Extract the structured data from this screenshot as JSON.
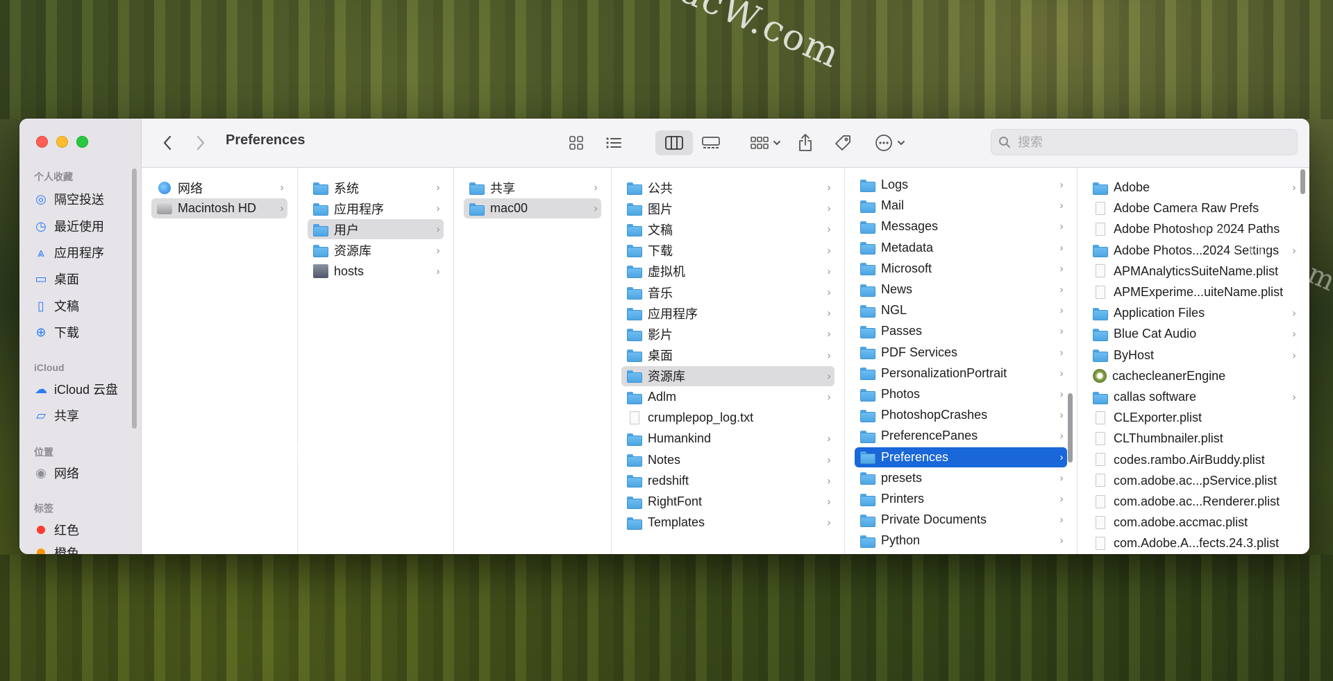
{
  "window": {
    "title": "Preferences"
  },
  "search": {
    "placeholder": "搜索",
    "value": ""
  },
  "watermark": "MacW.com",
  "sidebar": {
    "sections": [
      {
        "title": "个人收藏",
        "items": [
          {
            "label": "隔空投送",
            "icon": "airdrop-icon"
          },
          {
            "label": "最近使用",
            "icon": "clock-icon"
          },
          {
            "label": "应用程序",
            "icon": "applications-icon"
          },
          {
            "label": "桌面",
            "icon": "desktop-icon"
          },
          {
            "label": "文稿",
            "icon": "document-icon"
          },
          {
            "label": "下载",
            "icon": "download-icon"
          }
        ]
      },
      {
        "title": "iCloud",
        "items": [
          {
            "label": "iCloud 云盘",
            "icon": "cloud-icon"
          },
          {
            "label": "共享",
            "icon": "shared-folder-icon"
          }
        ]
      },
      {
        "title": "位置",
        "items": [
          {
            "label": "网络",
            "icon": "network-icon"
          }
        ]
      },
      {
        "title": "标签",
        "items": [
          {
            "label": "红色",
            "icon": "red-tag-icon",
            "color": "#ff3b30"
          },
          {
            "label": "橙色",
            "icon": "orange-tag-icon",
            "color": "#ff9500"
          }
        ]
      }
    ]
  },
  "columns": [
    {
      "items": [
        {
          "label": "网络",
          "icon": "globe",
          "sel": ""
        },
        {
          "label": "Macintosh HD",
          "icon": "disk",
          "sel": "grey"
        }
      ]
    },
    {
      "items": [
        {
          "label": "系统",
          "icon": "folder",
          "sel": ""
        },
        {
          "label": "应用程序",
          "icon": "folder",
          "sel": ""
        },
        {
          "label": "用户",
          "icon": "folder",
          "sel": "grey"
        },
        {
          "label": "资源库",
          "icon": "folder",
          "sel": ""
        },
        {
          "label": "hosts",
          "icon": "hosts",
          "sel": ""
        }
      ]
    },
    {
      "items": [
        {
          "label": "共享",
          "icon": "folder",
          "sel": ""
        },
        {
          "label": "mac00",
          "icon": "folder",
          "sel": "grey"
        }
      ]
    },
    {
      "items": [
        {
          "label": "公共",
          "icon": "folder",
          "sel": ""
        },
        {
          "label": "图片",
          "icon": "folder",
          "sel": ""
        },
        {
          "label": "文稿",
          "icon": "folder",
          "sel": ""
        },
        {
          "label": "下载",
          "icon": "folder",
          "sel": ""
        },
        {
          "label": "虚拟机",
          "icon": "folder",
          "sel": ""
        },
        {
          "label": "音乐",
          "icon": "folder",
          "sel": ""
        },
        {
          "label": "应用程序",
          "icon": "folder",
          "sel": ""
        },
        {
          "label": "影片",
          "icon": "folder",
          "sel": ""
        },
        {
          "label": "桌面",
          "icon": "folder",
          "sel": ""
        },
        {
          "label": "资源库",
          "icon": "folder",
          "sel": "grey"
        },
        {
          "label": "Adlm",
          "icon": "folder",
          "sel": ""
        },
        {
          "label": "crumplepop_log.txt",
          "icon": "file",
          "sel": "",
          "nochev": true
        },
        {
          "label": "Humankind",
          "icon": "folder",
          "sel": ""
        },
        {
          "label": "Notes",
          "icon": "folder",
          "sel": ""
        },
        {
          "label": "redshift",
          "icon": "folder",
          "sel": ""
        },
        {
          "label": "RightFont",
          "icon": "folder",
          "sel": ""
        },
        {
          "label": "Templates",
          "icon": "folder",
          "sel": ""
        }
      ]
    },
    {
      "items": [
        {
          "label": "Logs",
          "icon": "folder",
          "sel": ""
        },
        {
          "label": "Mail",
          "icon": "folder",
          "sel": ""
        },
        {
          "label": "Messages",
          "icon": "folder",
          "sel": ""
        },
        {
          "label": "Metadata",
          "icon": "folder",
          "sel": ""
        },
        {
          "label": "Microsoft",
          "icon": "folder",
          "sel": ""
        },
        {
          "label": "News",
          "icon": "folder",
          "sel": ""
        },
        {
          "label": "NGL",
          "icon": "folder",
          "sel": ""
        },
        {
          "label": "Passes",
          "icon": "folder",
          "sel": ""
        },
        {
          "label": "PDF Services",
          "icon": "folder",
          "sel": ""
        },
        {
          "label": "PersonalizationPortrait",
          "icon": "folder",
          "sel": ""
        },
        {
          "label": "Photos",
          "icon": "folder",
          "sel": ""
        },
        {
          "label": "PhotoshopCrashes",
          "icon": "folder",
          "sel": ""
        },
        {
          "label": "PreferencePanes",
          "icon": "folder",
          "sel": ""
        },
        {
          "label": "Preferences",
          "icon": "folder",
          "sel": "blue"
        },
        {
          "label": "presets",
          "icon": "folder",
          "sel": ""
        },
        {
          "label": "Printers",
          "icon": "folder",
          "sel": ""
        },
        {
          "label": "Private Documents",
          "icon": "folder",
          "sel": ""
        },
        {
          "label": "Python",
          "icon": "folder",
          "sel": ""
        }
      ]
    },
    {
      "items": [
        {
          "label": "Adobe",
          "icon": "folder",
          "sel": ""
        },
        {
          "label": "Adobe Camera Raw Prefs",
          "icon": "file",
          "sel": "",
          "nochev": true
        },
        {
          "label": "Adobe Photoshop 2024 Paths",
          "icon": "file",
          "sel": "",
          "nochev": true
        },
        {
          "label": "Adobe Photos...2024 Settings",
          "icon": "folder",
          "sel": ""
        },
        {
          "label": "APMAnalyticsSuiteName.plist",
          "icon": "file",
          "sel": "",
          "nochev": true
        },
        {
          "label": "APMExperime...uiteName.plist",
          "icon": "file",
          "sel": "",
          "nochev": true
        },
        {
          "label": "Application Files",
          "icon": "folder",
          "sel": ""
        },
        {
          "label": "Blue Cat Audio",
          "icon": "folder",
          "sel": ""
        },
        {
          "label": "ByHost",
          "icon": "folder",
          "sel": ""
        },
        {
          "label": "cachecleanerEngine",
          "icon": "app",
          "sel": "",
          "nochev": true
        },
        {
          "label": "callas software",
          "icon": "folder",
          "sel": ""
        },
        {
          "label": "CLExporter.plist",
          "icon": "file",
          "sel": "",
          "nochev": true
        },
        {
          "label": "CLThumbnailer.plist",
          "icon": "file",
          "sel": "",
          "nochev": true
        },
        {
          "label": "codes.rambo.AirBuddy.plist",
          "icon": "file",
          "sel": "",
          "nochev": true
        },
        {
          "label": "com.adobe.ac...pService.plist",
          "icon": "file",
          "sel": "",
          "nochev": true
        },
        {
          "label": "com.adobe.ac...Renderer.plist",
          "icon": "file",
          "sel": "",
          "nochev": true
        },
        {
          "label": "com.adobe.accmac.plist",
          "icon": "file",
          "sel": "",
          "nochev": true
        },
        {
          "label": "com.Adobe.A...fects.24.3.plist",
          "icon": "file",
          "sel": "",
          "nochev": true
        }
      ]
    }
  ]
}
